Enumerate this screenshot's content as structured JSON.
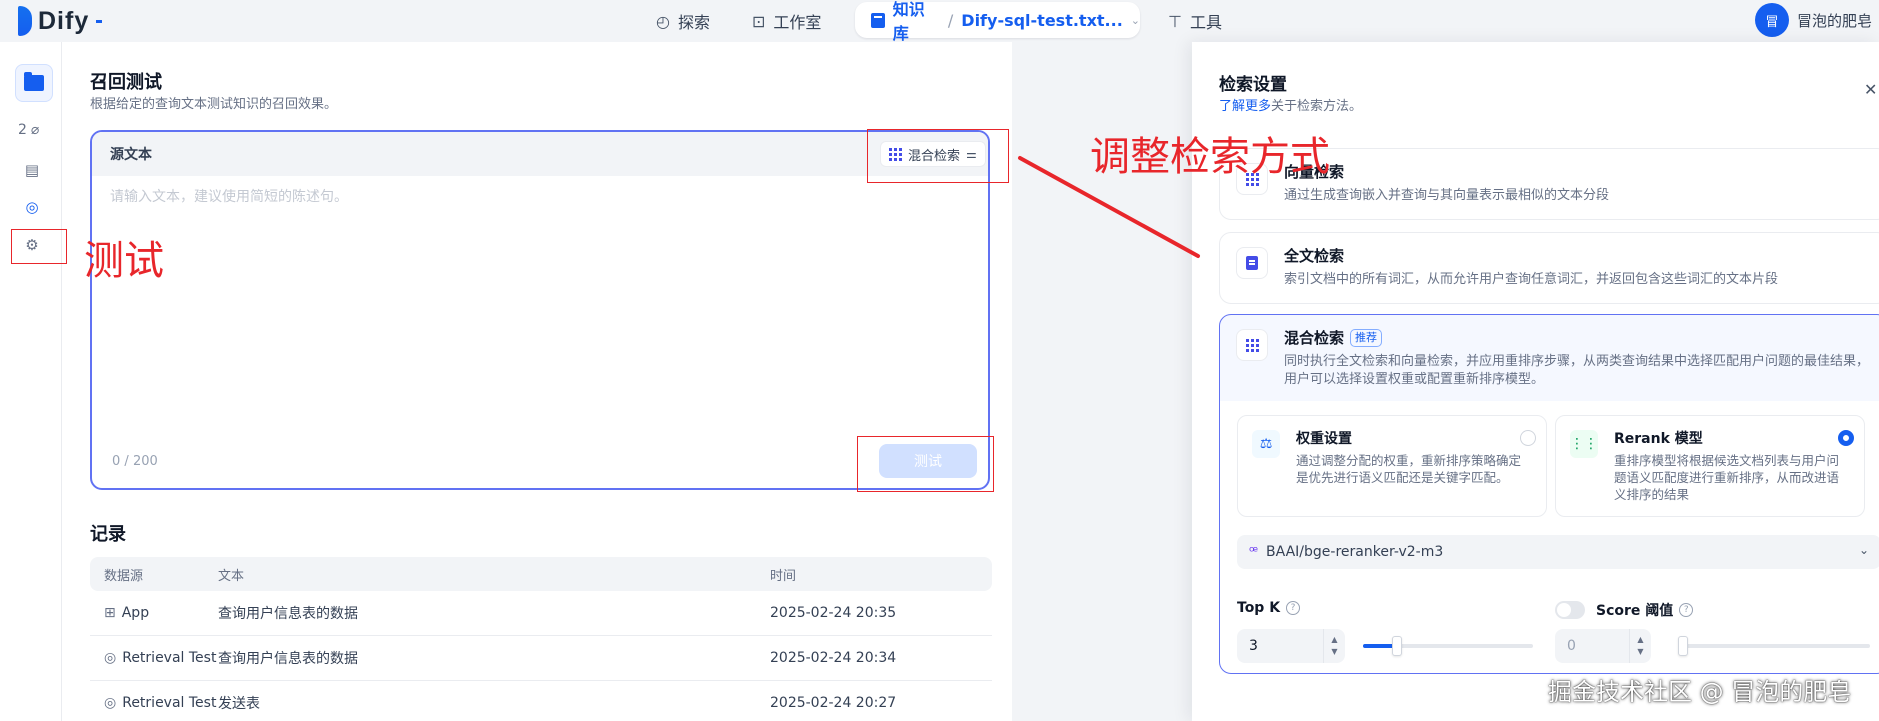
{
  "brand": {
    "name": "Dify"
  },
  "nav": {
    "explore": "探索",
    "studio": "工作室",
    "knowledge": "知识库",
    "separator": "/",
    "dataset_name": "Dify-sql-test.txt...",
    "tools": "工具"
  },
  "user": {
    "avatar_initial": "冒",
    "name": "冒泡的肥皂"
  },
  "sidebar": {
    "doc_count": "2"
  },
  "main": {
    "title": "召回测试",
    "description": "根据给定的查询文本测试知识的召回效果。",
    "source_label": "源文本",
    "mode_button": "混合检索",
    "input_placeholder": "请输入文本，建议使用简短的陈述句。",
    "counter_current": "0",
    "counter_max": "200",
    "test_button": "测试"
  },
  "records": {
    "title": "记录",
    "columns": [
      "数据源",
      "文本",
      "时间"
    ],
    "rows": [
      {
        "source": "App",
        "text": "查询用户信息表的数据",
        "time": "2025-02-24 20:35"
      },
      {
        "source": "Retrieval Test",
        "text": "查询用户信息表的数据",
        "time": "2025-02-24 20:34"
      },
      {
        "source": "Retrieval Test",
        "text": "发送表",
        "time": "2025-02-24 20:27"
      }
    ]
  },
  "panel": {
    "title": "检索设置",
    "learn_more": "了解更多",
    "subtitle_rest": "关于检索方法。",
    "options": [
      {
        "name": "向量检索",
        "desc": "通过生成查询嵌入并查询与其向量表示最相似的文本分段"
      },
      {
        "name": "全文检索",
        "desc": "索引文档中的所有词汇，从而允许用户查询任意词汇，并返回包含这些词汇的文本片段"
      },
      {
        "name": "混合检索",
        "badge": "推荐",
        "desc": "同时执行全文检索和向量检索，并应用重排序步骤，从两类查询结果中选择匹配用户问题的最佳结果，用户可以选择设置权重或配置重新排序模型。"
      }
    ],
    "weight": {
      "name": "权重设置",
      "desc": "通过调整分配的权重，重新排序策略确定是优先进行语义匹配还是关键字匹配。"
    },
    "rerank": {
      "name": "Rerank 模型",
      "desc": "重排序模型将根据候选文档列表与用户问题语义匹配度进行重新排序，从而改进语义排序的结果"
    },
    "model": "BAAI/bge-reranker-v2-m3",
    "topk": {
      "label": "Top K",
      "value": "3",
      "slider_fraction": 0.2
    },
    "score": {
      "label": "Score 阈值",
      "value": "0",
      "enabled": false
    }
  },
  "annotations": {
    "test": "测试",
    "adjust": "调整检索方式"
  },
  "watermark": "掘金技术社区 @ 冒泡的肥皂",
  "colors": {
    "accent": "#155eef",
    "annotation": "#e8262b"
  }
}
